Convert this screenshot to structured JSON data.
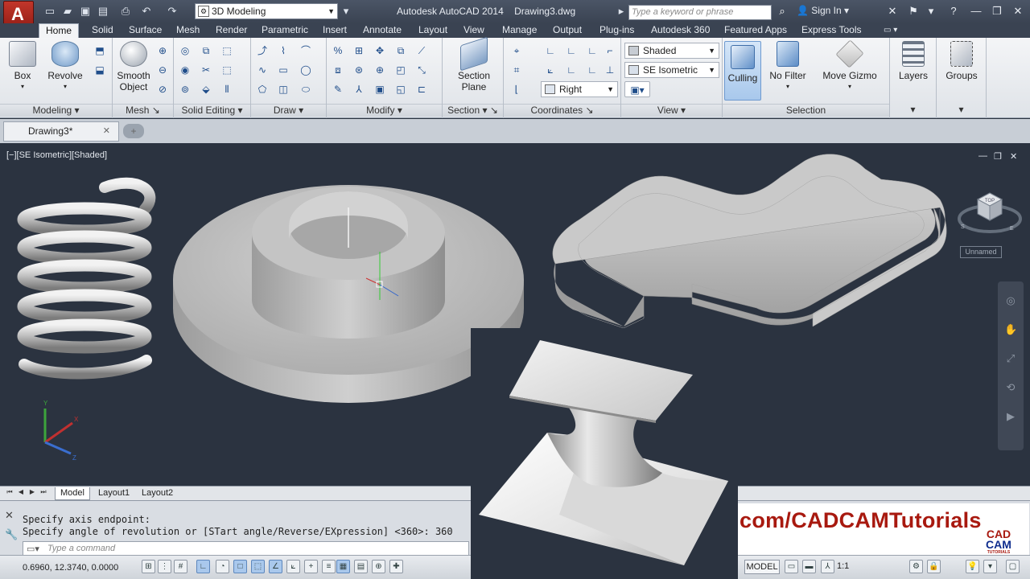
{
  "title_bar": {
    "workspace": "3D Modeling",
    "title": "Autodesk AutoCAD 2014    Drawing3.dwg",
    "search_placeholder": "Type a keyword or phrase",
    "sign_in": "Sign In"
  },
  "ribbon_tabs": [
    "Home",
    "Solid",
    "Surface",
    "Mesh",
    "Render",
    "Parametric",
    "Insert",
    "Annotate",
    "Layout",
    "View",
    "Manage",
    "Output",
    "Plug-ins",
    "Autodesk 360",
    "Featured Apps",
    "Express Tools"
  ],
  "ribbon": {
    "box_label": "Box",
    "revolve_label": "Revolve",
    "smooth_object_label_1": "Smooth",
    "smooth_object_label_2": "Object",
    "section_plane_label_1": "Section",
    "section_plane_label_2": "Plane",
    "visual_style": "Shaded",
    "view_preset": "SE Isometric",
    "named_view": "Right",
    "culling_label": "Culling",
    "no_filter_label": "No Filter",
    "move_gizmo_label": "Move Gizmo",
    "layers_label": "Layers",
    "groups_label": "Groups",
    "panels": {
      "modeling": "Modeling",
      "mesh": "Mesh",
      "solid_editing": "Solid Editing",
      "draw": "Draw",
      "modify": "Modify",
      "section": "Section",
      "coordinates": "Coordinates",
      "view": "View",
      "selection": "Selection"
    }
  },
  "document_tab": "Drawing3*",
  "viewport": {
    "label": "[−][SE Isometric][Shaded]",
    "wcs": "Unnamed",
    "viewcube_face": "TOP"
  },
  "layout_tabs": [
    "Model",
    "Layout1",
    "Layout2"
  ],
  "command": {
    "line1": "Specify axis endpoint:",
    "line2": "Specify angle of revolution or [STart angle/Reverse/EXpression] <360>: 360",
    "input_placeholder": "Type a command"
  },
  "status": {
    "coordinates": "0.6960, 12.3740, 0.0000",
    "model": "MODEL",
    "scale": "1:1"
  },
  "watermark": {
    "text": "com/CADCAMTutorials",
    "logo_line1": "CAD",
    "logo_line2": "CAM",
    "logo_line3": "TUTORIALS"
  },
  "colors": {
    "viewport_bg": "#2b3340",
    "brand_red": "#a8190f",
    "brand_blue": "#0f2d8e",
    "active_toggle": "#a9c8ec"
  }
}
